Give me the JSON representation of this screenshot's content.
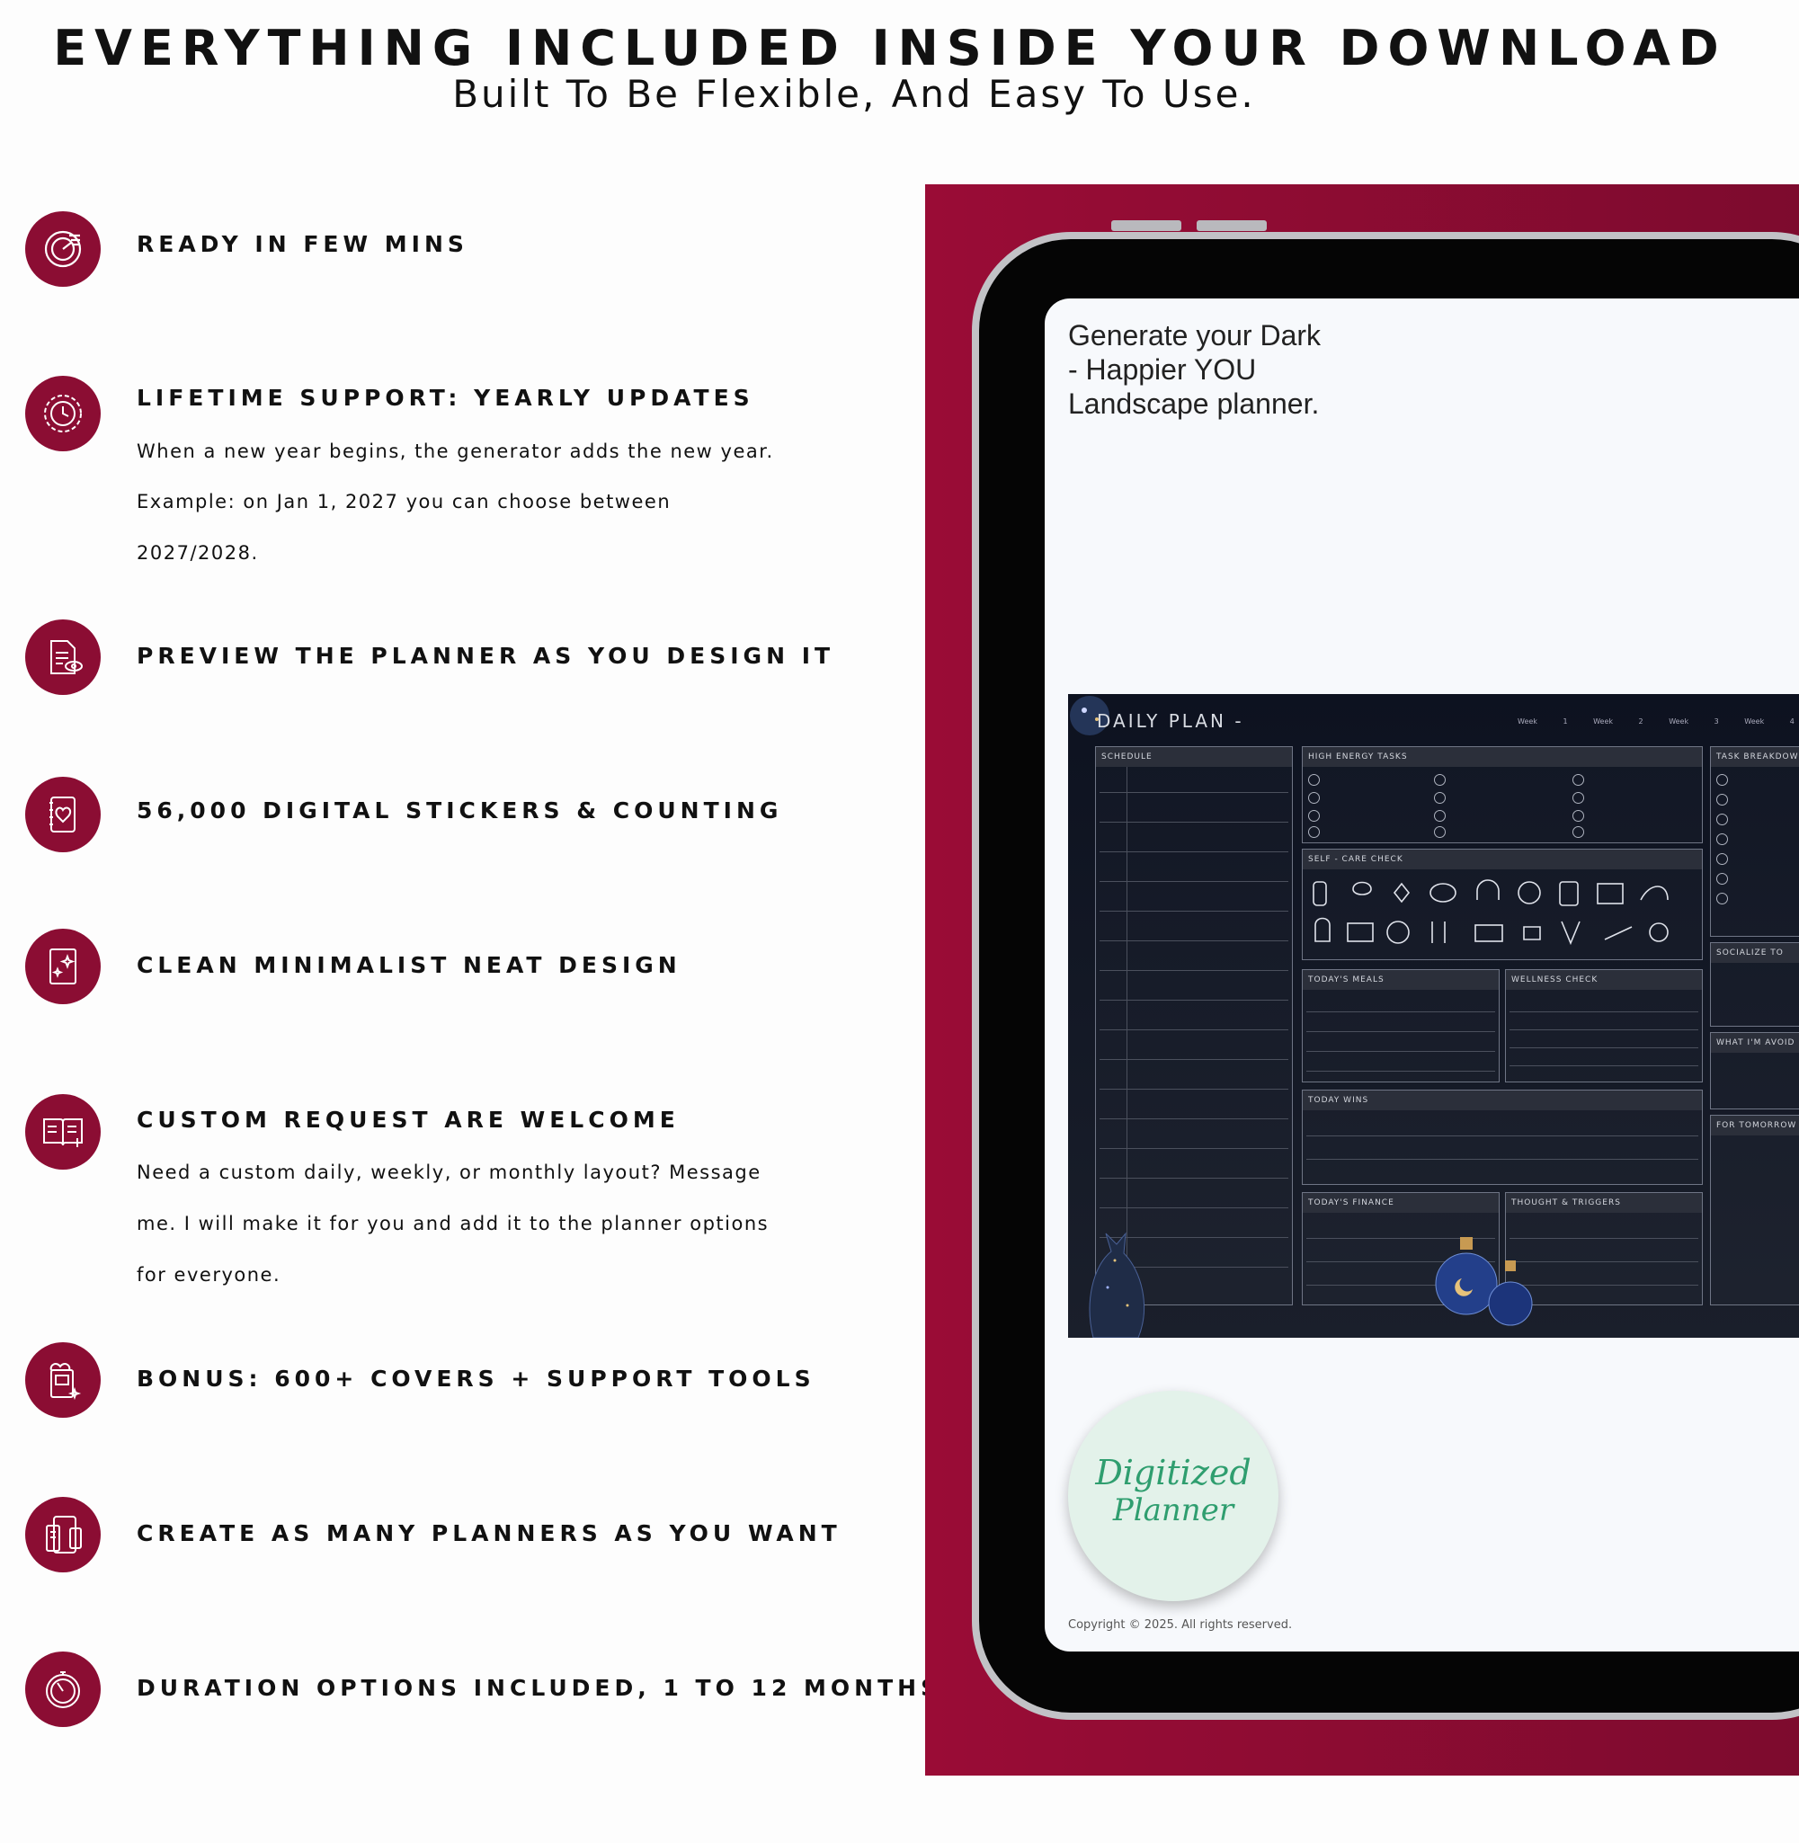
{
  "header": {
    "title": "EVERYTHING INCLUDED INSIDE YOUR DOWNLOAD",
    "subtitle": "Built To Be Flexible, And Easy To Use."
  },
  "features": [
    {
      "title": "READY IN FEW MINS",
      "icon": "speed-gauge-icon"
    },
    {
      "title": "LIFETIME SUPPORT: YEARLY UPDATES",
      "icon": "gear-clock-icon",
      "lines": [
        "When a new year begins, the generator adds the new year.",
        "Example: on Jan 1, 2027 you can choose between",
        "2027/2028."
      ]
    },
    {
      "title": "PREVIEW THE PLANNER AS YOU DESIGN IT",
      "icon": "document-eye-icon"
    },
    {
      "title": "56,000 DIGITAL STICKERS & COUNTING",
      "icon": "sticker-notebook-icon"
    },
    {
      "title": "CLEAN MINIMALIST NEAT DESIGN",
      "icon": "sparkle-page-icon"
    },
    {
      "title": "CUSTOM REQUEST ARE WELCOME",
      "icon": "open-book-plus-icon",
      "lines": [
        "Need a custom daily, weekly, or monthly layout? Message",
        "me. I will make it for you and add it to the planner options",
        "for everyone."
      ]
    },
    {
      "title": "BONUS: 600+ COVERS + SUPPORT TOOLS",
      "icon": "gift-cover-icon"
    },
    {
      "title": "CREATE AS MANY PLANNERS AS YOU WANT",
      "icon": "devices-icon"
    },
    {
      "title": "DURATION OPTIONS INCLUDED, 1 TO 12 MONTHS",
      "icon": "stopwatch-icon"
    }
  ],
  "promo": {
    "lines": [
      "Generate your Dark",
      "- Happier YOU",
      "Landscape planner."
    ],
    "seal_line1": "Digitized",
    "seal_line2": "Planner",
    "copyright": "Copyright © 2025. All rights reserved."
  },
  "daily_plan": {
    "title": "DAILY PLAN -",
    "tabs": "Week 1 Week 2 Week 3 Week 4",
    "schedule_header": "SCHEDULE",
    "priorities_header": "HIGH ENERGY TASKS",
    "selfcare_header": "SELF - CARE CHECK",
    "meals_header": "TODAY'S MEALS",
    "wellness_header": "WELLNESS CHECK",
    "wins_header": "TODAY WINS",
    "finance_header": "TODAY'S FINANCE",
    "thought_header": "THOUGHT & TRIGGERS",
    "right1_header": "TASK BREAKDOWN",
    "right2_header": "SOCIALIZE TO",
    "right3_header": "WHAT I'M AVOID",
    "right4_header": "FOR TOMORROW"
  },
  "colors": {
    "accent": "#8b0d33",
    "seal_text": "#2f9e6f"
  }
}
